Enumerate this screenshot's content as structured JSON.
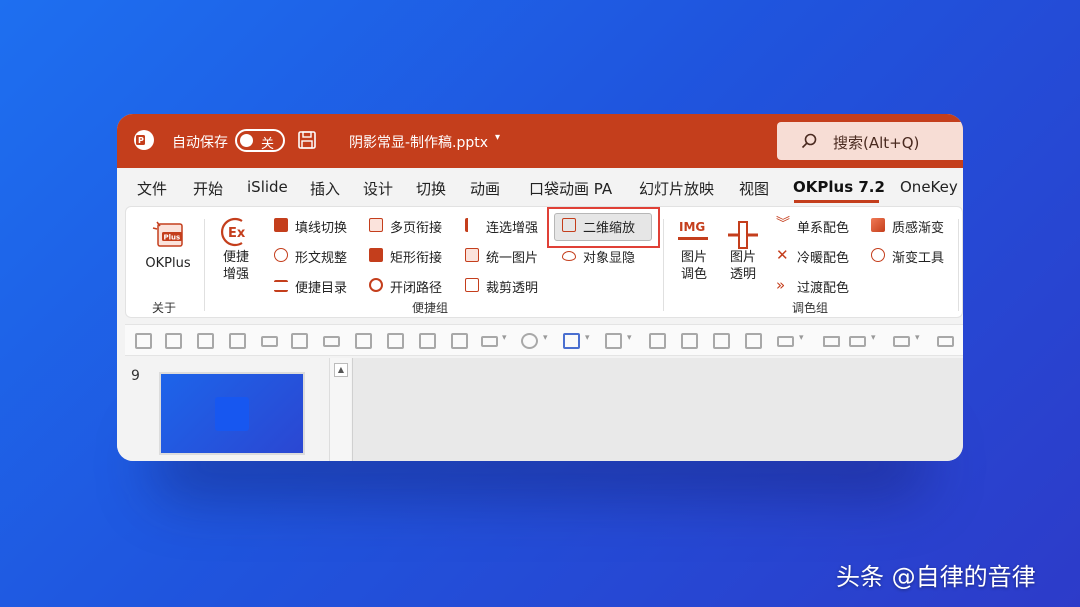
{
  "titlebar": {
    "autosave_label": "自动保存",
    "toggle_state": "关",
    "document_name": "阴影常显-制作稿.pptx",
    "dropdown_glyph": "▾",
    "search_placeholder": "搜索(Alt+Q)"
  },
  "menu": {
    "tabs": [
      "文件",
      "开始",
      "iSlide",
      "插入",
      "设计",
      "切换",
      "动画",
      "口袋动画 PA",
      "幻灯片放映",
      "视图",
      "OKPlus 7.2",
      "OneKey"
    ],
    "active_tab": "OKPlus 7.2"
  },
  "ribbon": {
    "about_group": {
      "button_label": "OKPlus",
      "group_label": "关于"
    },
    "convenience_group": {
      "big_button": [
        "便捷",
        "增强"
      ],
      "col1": [
        "填线切换",
        "形文规整",
        "便捷目录"
      ],
      "col2": [
        "多页衔接",
        "矩形衔接",
        "开闭路径"
      ],
      "col3": [
        "连选增强",
        "统一图片",
        "裁剪透明"
      ],
      "col4": [
        "二维缩放",
        "对象显隐"
      ],
      "group_label": "便捷组"
    },
    "color_group": {
      "img_button": [
        "图片",
        "调色"
      ],
      "transparent_button": [
        "图片",
        "透明"
      ],
      "img_icon_text": "IMG",
      "col1": [
        "单系配色",
        "冷暖配色",
        "过渡配色"
      ],
      "col2": [
        "质感渐变",
        "渐变工具"
      ],
      "group_label": "调色组"
    }
  },
  "slides": {
    "current_number": "9"
  },
  "watermark": "头条 @自律的音律",
  "colors": {
    "accent": "#c43e1c",
    "highlight_box": "#e04036",
    "background": "#1f5ae4"
  },
  "icons": {
    "scroll_up": "▲"
  }
}
